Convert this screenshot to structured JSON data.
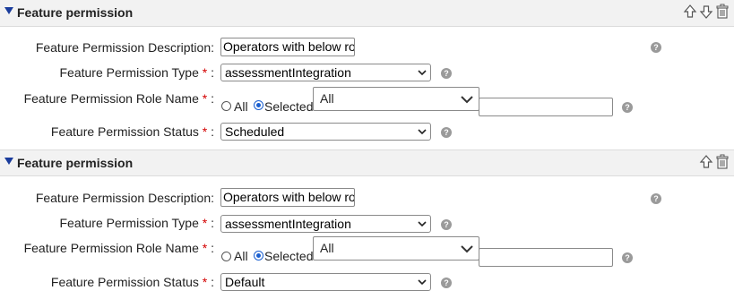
{
  "sections": [
    {
      "title": "Feature permission",
      "description_label": "Feature Permission Description:",
      "description_value": "Operators with below ro",
      "type_label": "Feature Permission Type",
      "type_value": "assessmentIntegration",
      "role_label": "Feature Permission Role Name",
      "role_all_label": "All",
      "role_selected_label": "Selected",
      "role_select_value": "All",
      "role_text_value": "",
      "status_label": "Feature Permission Status",
      "status_value": "Scheduled",
      "required_mark": "*",
      "label_colon": ":",
      "help_icon": "?"
    },
    {
      "title": "Feature permission",
      "description_label": "Feature Permission Description:",
      "description_value": "Operators with below ro",
      "type_label": "Feature Permission Type",
      "type_value": "assessmentIntegration",
      "role_label": "Feature Permission Role Name",
      "role_all_label": "All",
      "role_selected_label": "Selected",
      "role_select_value": "All",
      "role_text_value": "",
      "status_label": "Feature Permission Status",
      "status_value": "Default",
      "required_mark": "*",
      "label_colon": ":",
      "help_icon": "?"
    }
  ],
  "colors": {
    "header_bg": "#f2f2f2",
    "required": "#d40000",
    "toggle": "#1a3c9c"
  },
  "icons": [
    "collapse-triangle-icon",
    "move-up-icon",
    "move-down-icon",
    "delete-icon",
    "help-icon",
    "chevron-down-icon"
  ]
}
